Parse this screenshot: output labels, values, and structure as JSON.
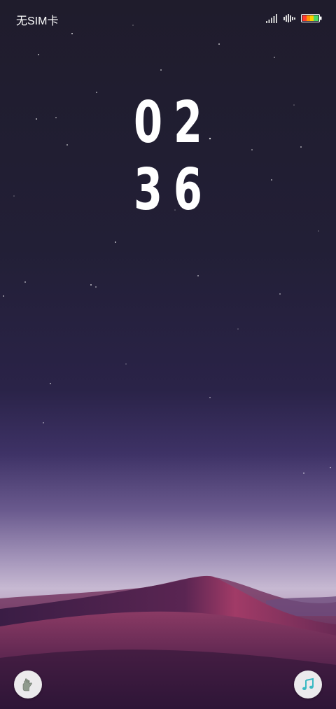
{
  "status_bar": {
    "carrier": "无SIM卡",
    "icons": [
      "signal-icon",
      "wifi-icon",
      "battery-icon"
    ]
  },
  "clock": {
    "hours": "02",
    "minutes": "36"
  },
  "shortcuts": {
    "left_icon": "hand-icon",
    "right_icon": "music-note-icon"
  },
  "colors": {
    "sky_top": "#1f1c2c",
    "horizon": "#c7b9d2",
    "dune": "#7a2b5a",
    "battery_fill": [
      "#ff3b30",
      "#ff9500",
      "#ffcc00",
      "#4cd964"
    ]
  }
}
